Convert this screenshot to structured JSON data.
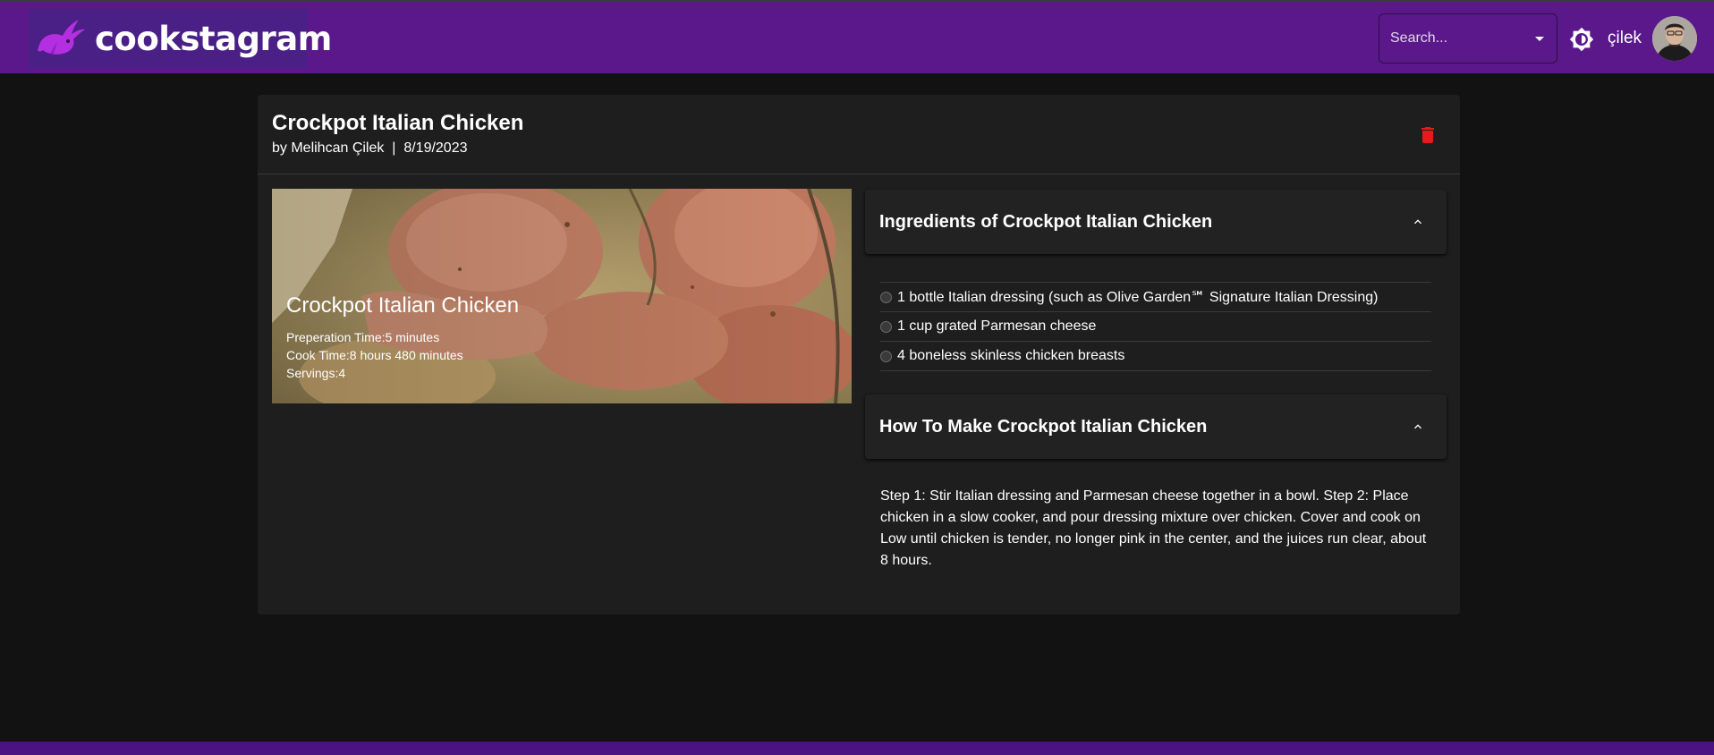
{
  "app": {
    "brand": "cookstagram",
    "colors": {
      "appbar": "#5b188b",
      "background": "#121212",
      "card": "#1e1e1e",
      "delete": "#e31b1b"
    }
  },
  "header": {
    "search_placeholder": "Search...",
    "theme_icon": "brightness-icon",
    "username": "çilek"
  },
  "recipe": {
    "title": "Crockpot Italian Chicken",
    "subheader": "by Melihcan Çilek  |  8/19/2023",
    "media": {
      "title": "Crockpot Italian Chicken",
      "prep": "Preperation Time:5 minutes",
      "cook": "Cook Time:8 hours 480 minutes",
      "servings": "Servings:4"
    },
    "ingredients_heading": "Ingredients of Crockpot Italian Chicken",
    "ingredients": [
      "1 bottle Italian dressing (such as Olive Garden℠ Signature Italian Dressing)",
      "1 cup grated Parmesan cheese",
      "4 boneless skinless chicken breasts"
    ],
    "howto_heading": "How To Make Crockpot Italian Chicken",
    "steps": "Step 1: Stir Italian dressing and Parmesan cheese together in a bowl. Step 2: Place chicken in a slow cooker, and pour dressing mixture over chicken. Cover and cook on Low until chicken is tender, no longer pink in the center, and the juices run clear, about 8 hours."
  }
}
